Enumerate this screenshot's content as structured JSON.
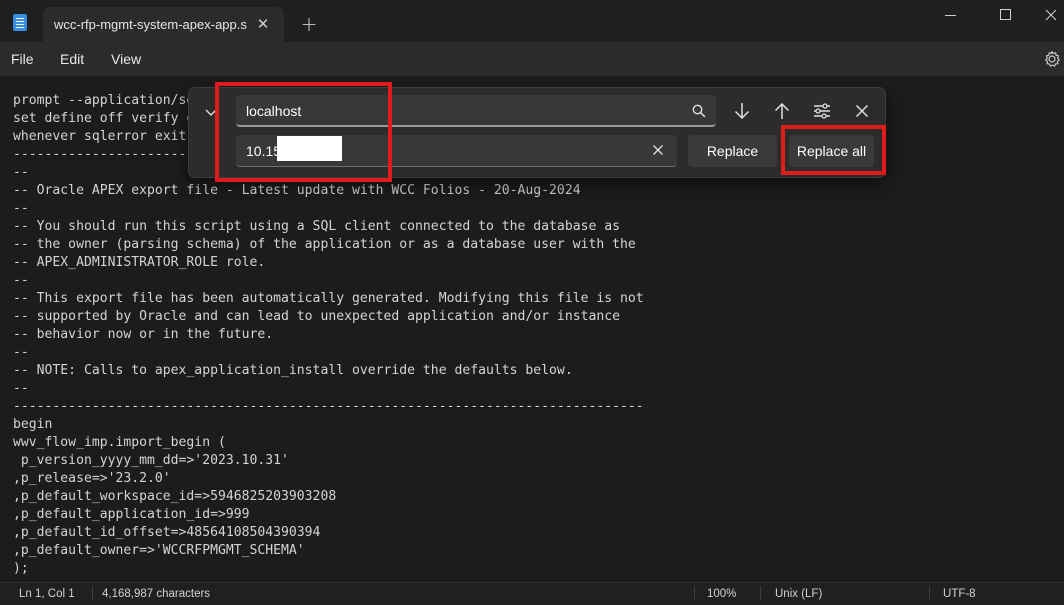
{
  "window": {
    "tab_title": "wcc-rfp-mgmt-system-apex-app.s",
    "tab_close": "✕",
    "new_tab": "+"
  },
  "menu": {
    "file": "File",
    "edit": "Edit",
    "view": "View"
  },
  "find_replace": {
    "find_value": "localhost",
    "replace_value": "10.15",
    "replace_label": "Replace",
    "replace_all_label": "Replace all"
  },
  "editor": {
    "lines": [
      "prompt --application/set_environment",
      "set define off verify off feedback off",
      "whenever sqlerror exit sql.sqlcode rollback",
      "--------------------------------------------------------------------------------",
      "--",
      "-- Oracle APEX export file - Latest update with WCC Folios - 20-Aug-2024",
      "--",
      "-- You should run this script using a SQL client connected to the database as",
      "-- the owner (parsing schema) of the application or as a database user with the",
      "-- APEX_ADMINISTRATOR_ROLE role.",
      "--",
      "-- This export file has been automatically generated. Modifying this file is not",
      "-- supported by Oracle and can lead to unexpected application and/or instance",
      "-- behavior now or in the future.",
      "--",
      "-- NOTE: Calls to apex_application_install override the defaults below.",
      "--",
      "--------------------------------------------------------------------------------",
      "begin",
      "wwv_flow_imp.import_begin (",
      " p_version_yyyy_mm_dd=>'2023.10.31'",
      ",p_release=>'23.2.0'",
      ",p_default_workspace_id=>5946825203903208",
      ",p_default_application_id=>999",
      ",p_default_id_offset=>48564108504390394",
      ",p_default_owner=>'WCCRFPMGMT_SCHEMA'",
      ");"
    ]
  },
  "status": {
    "position": "Ln 1, Col 1",
    "characters": "4,168,987 characters",
    "zoom": "100%",
    "line_ending": "Unix (LF)",
    "encoding": "UTF-8"
  },
  "colors": {
    "highlight": "#e01b1b",
    "background": "#1c1c1c",
    "panel": "#2c2c2c"
  },
  "icons": [
    "notepad-icon",
    "close-icon",
    "plus-icon",
    "minimize-icon",
    "maximize-icon",
    "settings-icon",
    "chevron-down-icon",
    "search-icon",
    "clear-icon",
    "arrow-down-icon",
    "arrow-up-icon",
    "options-icon"
  ]
}
